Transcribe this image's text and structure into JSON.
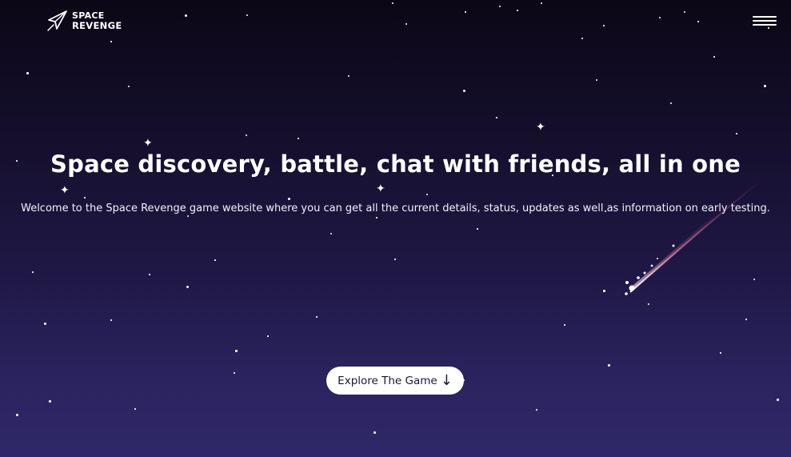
{
  "header": {
    "logo_line1": "SPACE",
    "logo_line2": "REVENGE"
  },
  "hero": {
    "title": "Space discovery, battle, chat with friends, all in one",
    "subtitle": "Welcome to the Space Revenge game website where you can get all the current details, status, updates as well as information on early testing."
  },
  "cta": {
    "label": "Explore The Game",
    "icon": "arrow-down-icon",
    "icon_glyph": "↓"
  },
  "colors": {
    "background_top": "#0b0716",
    "background_bottom": "#2f2868",
    "button_bg": "#ffffff",
    "button_text": "#1b1638",
    "text": "#ffffff"
  }
}
